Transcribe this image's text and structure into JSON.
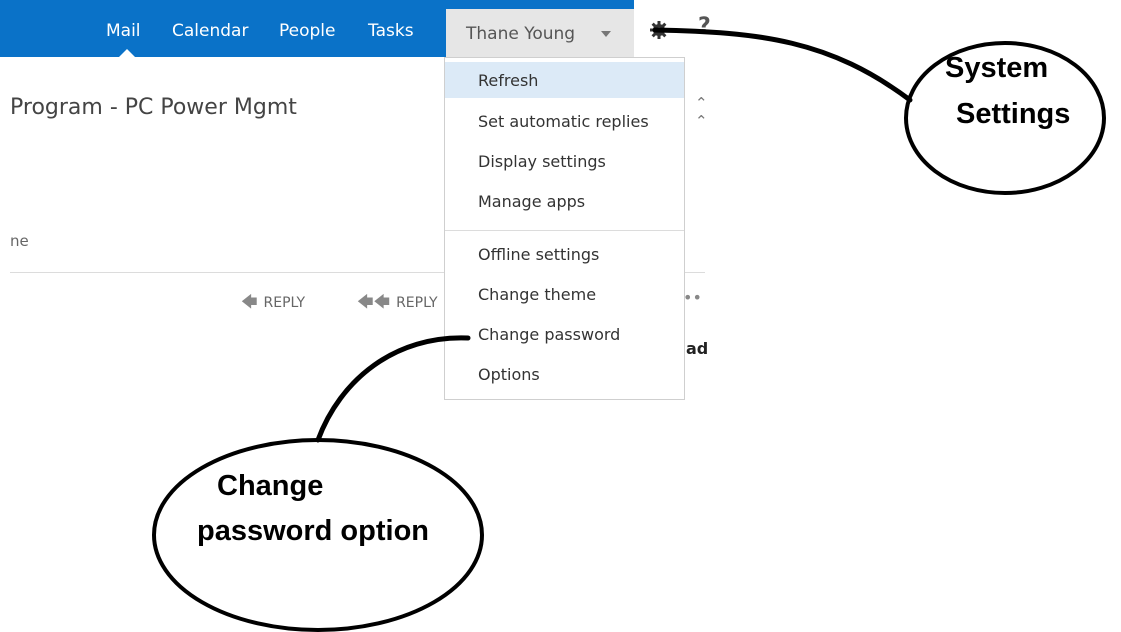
{
  "nav": {
    "items": [
      "Mail",
      "Calendar",
      "People",
      "Tasks"
    ],
    "active_index": 0,
    "user_name": "Thane Young",
    "help_label": "?"
  },
  "email": {
    "subject": "Program - PC Power Mgmt",
    "sender_fragment": "ne",
    "reply_label": "REPLY",
    "reply_all_label": "REPLY",
    "more_label": "••",
    "side_fragment": "ad"
  },
  "settings_menu": {
    "items": [
      {
        "label": "Refresh"
      },
      {
        "label": "Set automatic replies"
      },
      {
        "label": "Display settings"
      },
      {
        "label": "Manage apps"
      },
      {
        "label": "Offline settings"
      },
      {
        "label": "Change theme"
      },
      {
        "label": "Change password"
      },
      {
        "label": "Options"
      }
    ],
    "highlighted_index": 0
  },
  "annotations": {
    "system_settings": [
      "System",
      "Settings"
    ],
    "change_password": [
      "Change",
      "password option"
    ]
  },
  "colors": {
    "nav_bar": "#0a72c8",
    "highlight": "#dceaf7"
  }
}
